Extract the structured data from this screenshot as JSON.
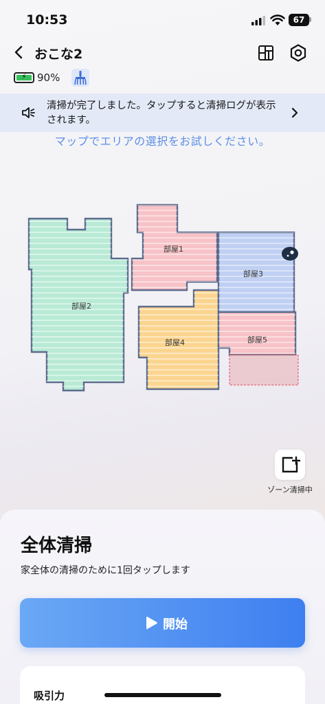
{
  "status": {
    "time": "10:53",
    "battery": "67"
  },
  "header": {
    "title": "おこな2"
  },
  "device": {
    "battery_pct": "90%"
  },
  "notice": {
    "text": "清掃が完了しました。タップすると清掃ログが表示されます。"
  },
  "map": {
    "hint": "マップでエリアの選択をお試しください。",
    "rooms": [
      {
        "label": "部屋1",
        "color": "#f7c3c8"
      },
      {
        "label": "部屋2",
        "color": "#b9ead6"
      },
      {
        "label": "部屋3",
        "color": "#bfd0f3"
      },
      {
        "label": "部屋4",
        "color": "#fbd590"
      },
      {
        "label": "部屋5",
        "color": "#f7c3c8"
      }
    ],
    "wall_color": "#5c6b8c"
  },
  "zone": {
    "label": "ゾーン清掃中"
  },
  "clean": {
    "title": "全体清掃",
    "subtitle": "家全体の清掃のために1回タップします",
    "start_label": "開始",
    "accent": "#3e7ff0"
  },
  "settings": {
    "suction_label": "吸引力"
  }
}
